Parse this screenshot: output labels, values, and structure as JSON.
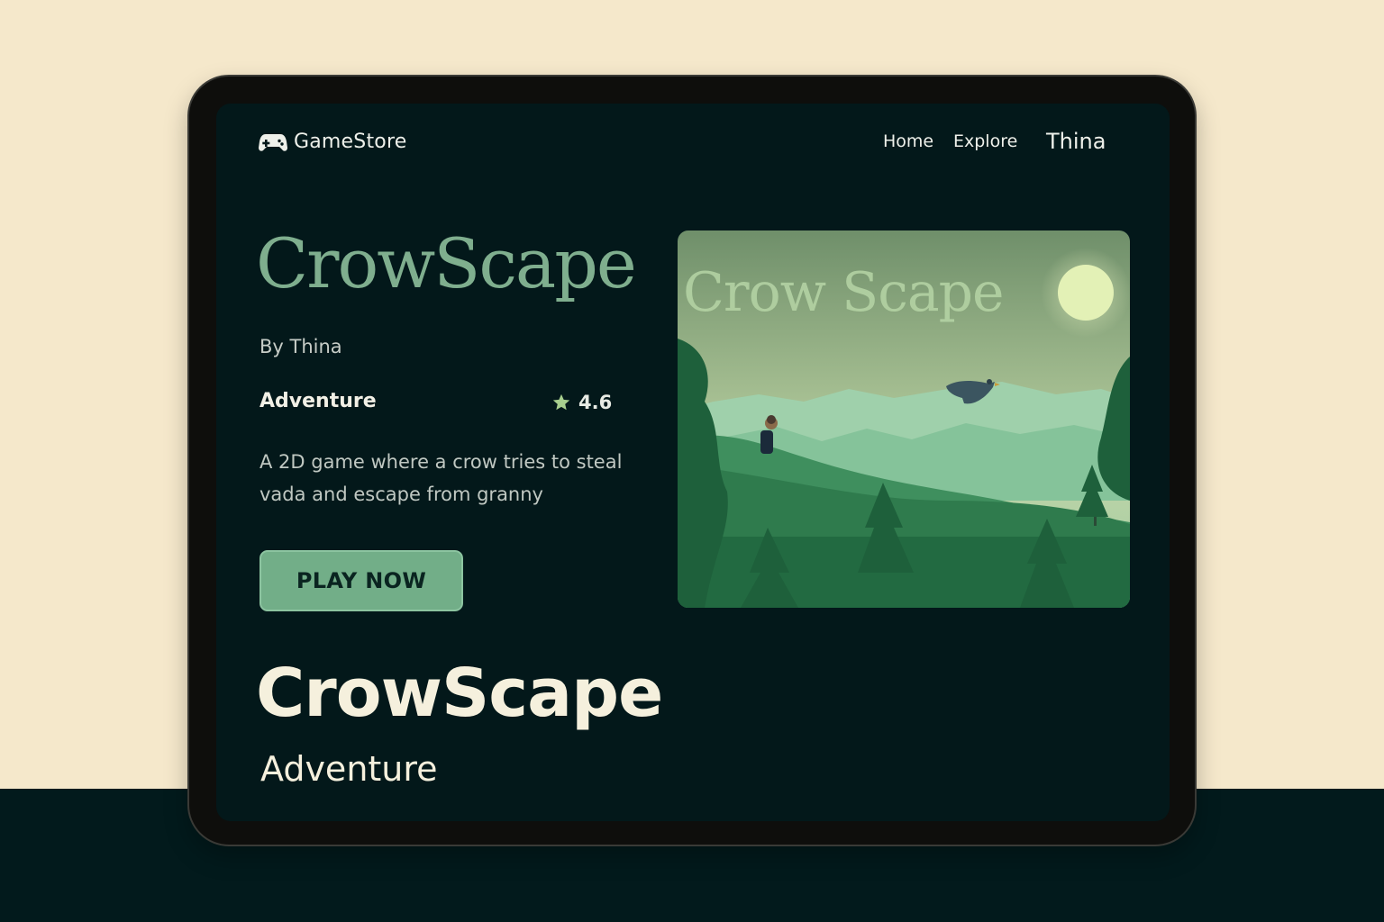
{
  "header": {
    "brand": "GameStore",
    "brand_icon": "gamepad-icon",
    "nav": [
      "Home",
      "Explore"
    ],
    "user": "Thina"
  },
  "game": {
    "title": "CrowScape",
    "byline": "By Thina",
    "genre": "Adventure",
    "rating": "4.6",
    "rating_icon": "star-icon",
    "description": "A 2D game where a crow tries to steal vada and escape from granny",
    "cta": "PLAY NOW",
    "cover_title": "Crow Scape"
  },
  "bottom": {
    "title": "CrowScape",
    "genre": "Adventure"
  },
  "colors": {
    "page_bg": "#f5e8cb",
    "floor": "#021a1c",
    "screen_bg": "#03181a",
    "accent": "#72ae88",
    "title_green": "#7fae8e",
    "star": "#a8cf8e"
  }
}
